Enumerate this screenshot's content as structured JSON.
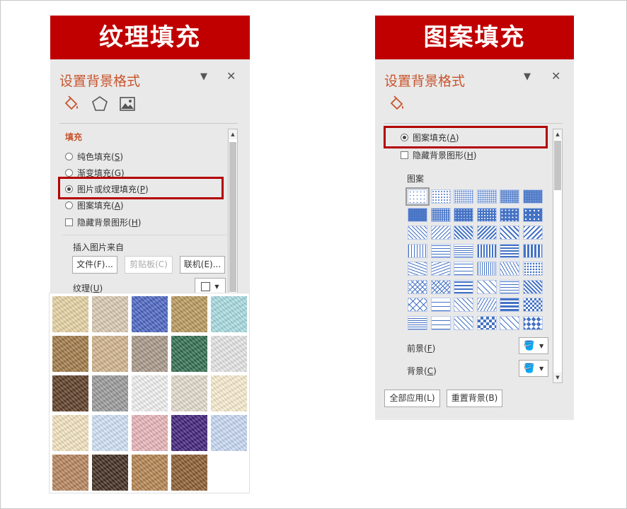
{
  "left": {
    "banner": "纹理填充",
    "pane_title": "设置背景格式",
    "section_fill": "填充",
    "options": [
      {
        "pre": "纯色填充(",
        "key": "S",
        "post": ")",
        "type": "radio",
        "selected": false
      },
      {
        "pre": "渐变填充(",
        "key": "G",
        "post": ")",
        "type": "radio",
        "selected": false
      },
      {
        "pre": "图片或纹理填充(",
        "key": "P",
        "post": ")",
        "type": "radio",
        "selected": true
      },
      {
        "pre": "图案填充(",
        "key": "A",
        "post": ")",
        "type": "radio",
        "selected": false
      },
      {
        "pre": "隐藏背景图形(",
        "key": "H",
        "post": ")",
        "type": "checkbox",
        "selected": false
      }
    ],
    "insert_from": "插入图片来自",
    "btn_file": "文件(F)...",
    "btn_clipboard": "剪贴板(C)",
    "btn_online": "联机(E)...",
    "texture_label_pre": "纹理(",
    "texture_key": "U",
    "texture_label_post": ")",
    "textures": [
      "papyrus",
      "canvas",
      "denim",
      "woven-mat",
      "water-droplets",
      "brown-paper-bag",
      "fish-fossil",
      "sand",
      "green-marble",
      "white-marble",
      "brown-marble",
      "granite",
      "newsprint",
      "recycled-paper",
      "parchment",
      "bouquet",
      "blue-tissue-paper",
      "pink-tissue-paper",
      "purple-mesh",
      "stationery",
      "cork",
      "walnut",
      "oak",
      "medium-wood"
    ],
    "texture_colors": [
      "#e7d3a2",
      "#d9cbb2",
      "#4a64c4",
      "#b9995a",
      "#a8dde2",
      "#a07845",
      "#d2b48b",
      "#a89888",
      "#2e6d4d",
      "#e6e6e6",
      "#5a3a22",
      "#9a9a9a",
      "#f2f2f2",
      "#e3dccc",
      "#faeed0",
      "#f4e4c0",
      "#d0e2f6",
      "#eab4b9",
      "#3d1e77",
      "#c8d9f4",
      "#b7835a",
      "#3e2a1c",
      "#b4824e",
      "#8a5a2e"
    ]
  },
  "right": {
    "banner": "图案填充",
    "pane_title": "设置背景格式",
    "option_pattern": {
      "pre": "图案填充(",
      "key": "A",
      "post": ")",
      "selected": true
    },
    "option_hide": {
      "pre": "隐藏背景图形(",
      "key": "H",
      "post": ")",
      "selected": false
    },
    "pattern_label": "图案",
    "foreground_pre": "前景(",
    "foreground_key": "F",
    "foreground_post": ")",
    "background_pre": "背景(",
    "background_key": "C",
    "background_post": ")",
    "btn_apply_all": "全部应用(L)",
    "btn_reset": "重置背景(B)",
    "pattern_color": "#4472c4",
    "pattern_count": 48
  },
  "colors": {
    "accent": "#c00000",
    "title": "#c8542c",
    "panel": "#e9e9e9"
  }
}
